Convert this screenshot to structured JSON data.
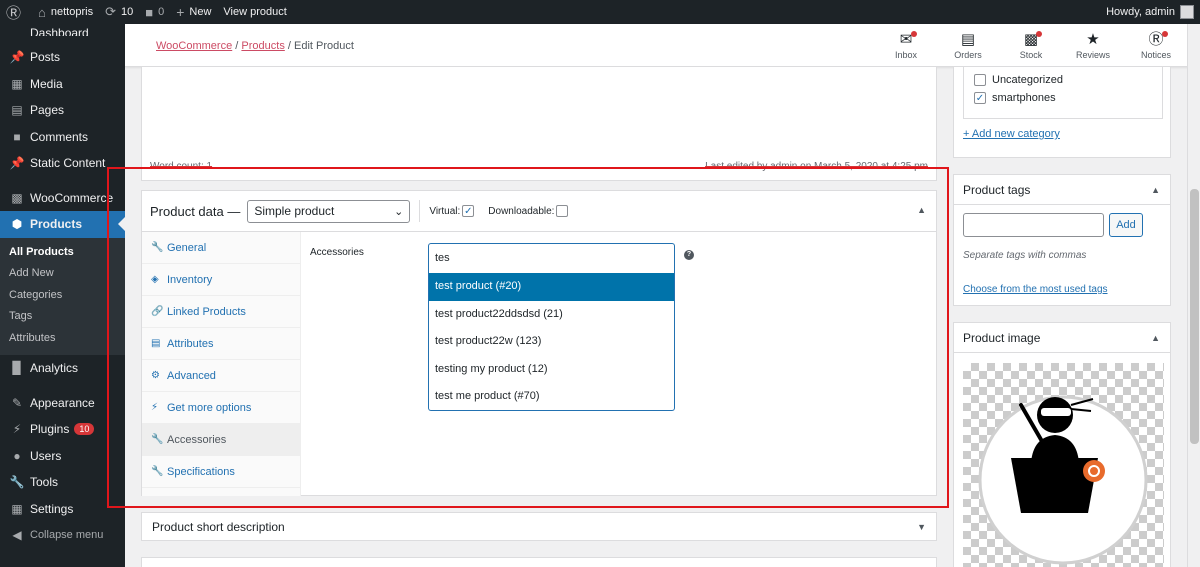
{
  "admin_bar": {
    "site_name": "nettopris",
    "updates_count": "10",
    "comments_count": "0",
    "new_label": "New",
    "view_label": "View product",
    "howdy": "Howdy, admin"
  },
  "sidebar": {
    "dashboard": "Dashboard",
    "posts": "Posts",
    "media": "Media",
    "pages": "Pages",
    "comments": "Comments",
    "static_content": "Static Content",
    "woocommerce": "WooCommerce",
    "products": "Products",
    "sub": [
      "All Products",
      "Add New",
      "Categories",
      "Tags",
      "Attributes"
    ],
    "analytics": "Analytics",
    "appearance": "Appearance",
    "plugins": "Plugins",
    "plugins_badge": "10",
    "users": "Users",
    "tools": "Tools",
    "settings": "Settings",
    "collapse": "Collapse menu"
  },
  "header": {
    "crumb_1": "WooCommerce",
    "crumb_2": "Products",
    "crumb_3": "Edit Product",
    "inbox": "Inbox",
    "orders": "Orders",
    "stock": "Stock",
    "reviews": "Reviews",
    "notices": "Notices"
  },
  "editor": {
    "word_count": "Word count: 1",
    "last_edited": "Last edited by admin on March 5, 2020 at 4:25 pm"
  },
  "product_data": {
    "title": "Product data —",
    "type_selected": "Simple product",
    "virtual_label": "Virtual:",
    "virtual_checked": true,
    "downloadable_label": "Downloadable:",
    "downloadable_checked": false,
    "tabs": [
      "General",
      "Inventory",
      "Linked Products",
      "Attributes",
      "Advanced",
      "Get more options",
      "Accessories",
      "Specifications"
    ],
    "active_tab": "Accessories",
    "accessories_label": "Accessories",
    "search_value": "tes",
    "results": [
      "test product (#20)",
      "test product22ddsdsd (21)",
      "test product22w (123)",
      "testing my product (12)",
      "test me product (#70)"
    ],
    "highlighted_result": "test product (#20)"
  },
  "short_description": {
    "title": "Product short description"
  },
  "categories": {
    "items": [
      "Uncategorized",
      "smartphones"
    ],
    "checked": [
      false,
      true
    ],
    "add_link": "+ Add new category"
  },
  "tags": {
    "title": "Product tags",
    "input_value": "",
    "add_button": "Add",
    "hint": "Separate tags with commas",
    "used_link": "Choose from the most used tags"
  },
  "product_image": {
    "title": "Product image"
  },
  "colors": {
    "accent": "#2271b1",
    "highlight_border": "#e0161b",
    "admin_dark": "#1d2327",
    "wc_link": "#cc4b64"
  }
}
